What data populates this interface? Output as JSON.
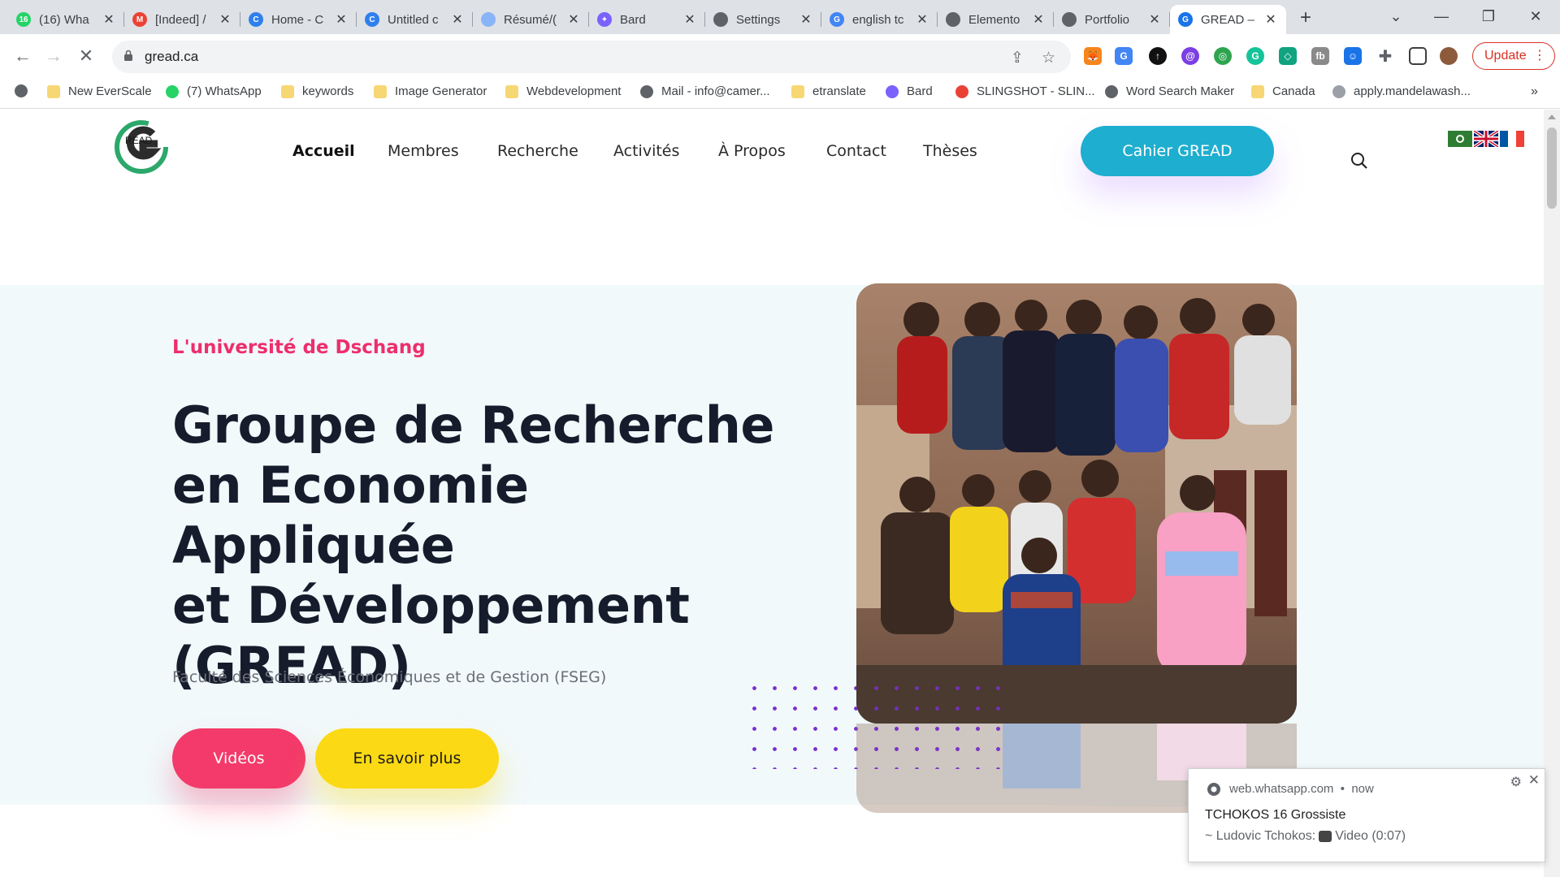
{
  "browser": {
    "tabs": [
      {
        "label": "(16) Wha",
        "favicon": "whatsapp-icon",
        "favicon_text": "16",
        "color": "#25d366"
      },
      {
        "label": "[Indeed] /",
        "favicon": "gmail-icon",
        "favicon_text": "M",
        "color": "#ea4335"
      },
      {
        "label": "Home - C",
        "favicon": "canva-icon",
        "favicon_text": "C",
        "color": "#2f80ed"
      },
      {
        "label": "Untitled c",
        "favicon": "canva-icon",
        "favicon_text": "C",
        "color": "#2f80ed"
      },
      {
        "label": "Résumé/(",
        "favicon": "doc-icon",
        "favicon_text": "",
        "color": "#8ab4f8"
      },
      {
        "label": "Bard",
        "favicon": "bard-icon",
        "favicon_text": "✦",
        "color": "#7b61ff"
      },
      {
        "label": "Settings",
        "favicon": "globe-icon",
        "favicon_text": "",
        "color": "#5f6368"
      },
      {
        "label": "english tc",
        "favicon": "google-icon",
        "favicon_text": "G",
        "color": "#4285f4"
      },
      {
        "label": "Elemento",
        "favicon": "globe-icon",
        "favicon_text": "",
        "color": "#5f6368"
      },
      {
        "label": "Portfolio",
        "favicon": "globe-icon",
        "favicon_text": "",
        "color": "#5f6368"
      },
      {
        "label": "GREAD –",
        "favicon": "gread-favicon",
        "favicon_text": "G",
        "color": "#1a73e8",
        "active": true
      }
    ],
    "url": "gread.ca",
    "update_label": "Update",
    "bookmarks": [
      {
        "label": "New EverScale",
        "icon": "folder-icon"
      },
      {
        "label": "(7) WhatsApp",
        "icon": "whatsapp-icon"
      },
      {
        "label": "keywords",
        "icon": "folder-icon"
      },
      {
        "label": "Image Generator",
        "icon": "folder-icon"
      },
      {
        "label": "Webdevelopment",
        "icon": "folder-icon"
      },
      {
        "label": "Mail - info@camer...",
        "icon": "globe-icon"
      },
      {
        "label": "etranslate",
        "icon": "folder-icon"
      },
      {
        "label": "Bard",
        "icon": "bard-icon"
      },
      {
        "label": "SLINGSHOT - SLIN...",
        "icon": "slingshot-icon"
      },
      {
        "label": "Word Search Maker",
        "icon": "globe-icon"
      },
      {
        "label": "Canada",
        "icon": "folder-icon"
      },
      {
        "label": "apply.mandelawash...",
        "icon": "doc-icon"
      }
    ]
  },
  "site": {
    "nav": [
      "Accueil",
      "Membres",
      "Recherche",
      "Activités",
      "À Propos",
      "Contact",
      "Thèses"
    ],
    "cta_label": "Cahier GREAD",
    "logo_text": "READ",
    "hero": {
      "kicker": "L'université de Dschang",
      "title_lines": [
        "Groupe de Recherche",
        "en Economie Appliquée",
        "et Développement",
        "(GREAD)"
      ],
      "subtitle": "Faculté des Sciences Économiques et de Gestion (FSEG)",
      "btn_videos": "Vidéos",
      "btn_more": "En savoir plus"
    },
    "colors": {
      "accent_pink": "#f33a6a",
      "accent_yellow": "#fbd914",
      "accent_teal": "#1eaecf",
      "dots_purple": "#7a2fd0"
    }
  },
  "notification": {
    "site": "web.whatsapp.com",
    "time": "now",
    "title": "TCHOKOS 16 Grossiste",
    "sender": "~ Ludovic Tchokos:",
    "message": "Video (0:07)"
  }
}
